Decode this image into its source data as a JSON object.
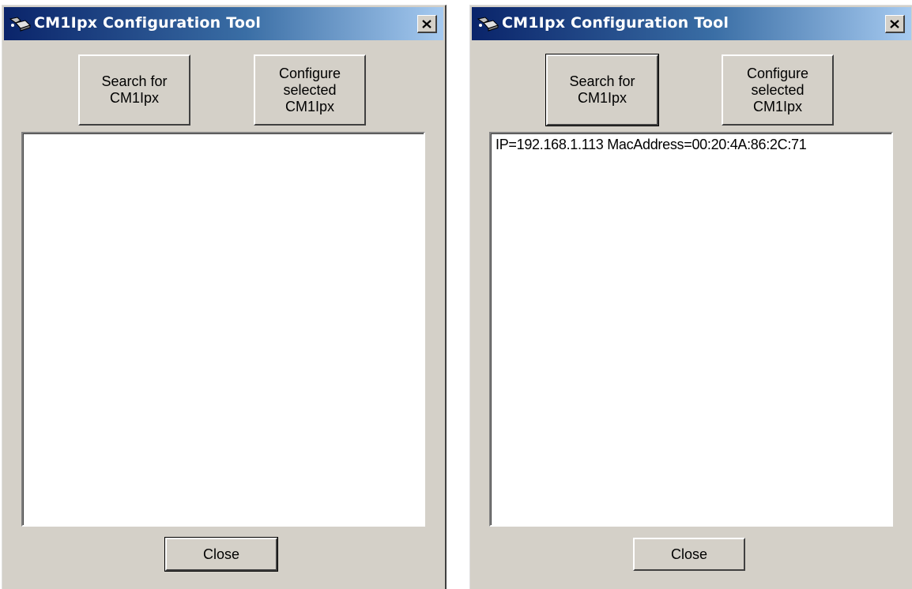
{
  "windows": [
    {
      "title": "CM1Ipx Configuration Tool",
      "search_button_label": "Search for\nCM1Ipx",
      "configure_button_label": "Configure\nselected\nCM1Ipx",
      "close_button_label": "Close",
      "device_list": []
    },
    {
      "title": "CM1Ipx Configuration Tool",
      "search_button_label": "Search for\nCM1Ipx",
      "configure_button_label": "Configure\nselected\nCM1Ipx",
      "close_button_label": "Close",
      "device_list": [
        "IP=192.168.1.113 MacAddress=00:20:4A:86:2C:71"
      ]
    }
  ],
  "icons": {
    "app_icon": "network-device-icon",
    "title_close": "close-icon"
  }
}
